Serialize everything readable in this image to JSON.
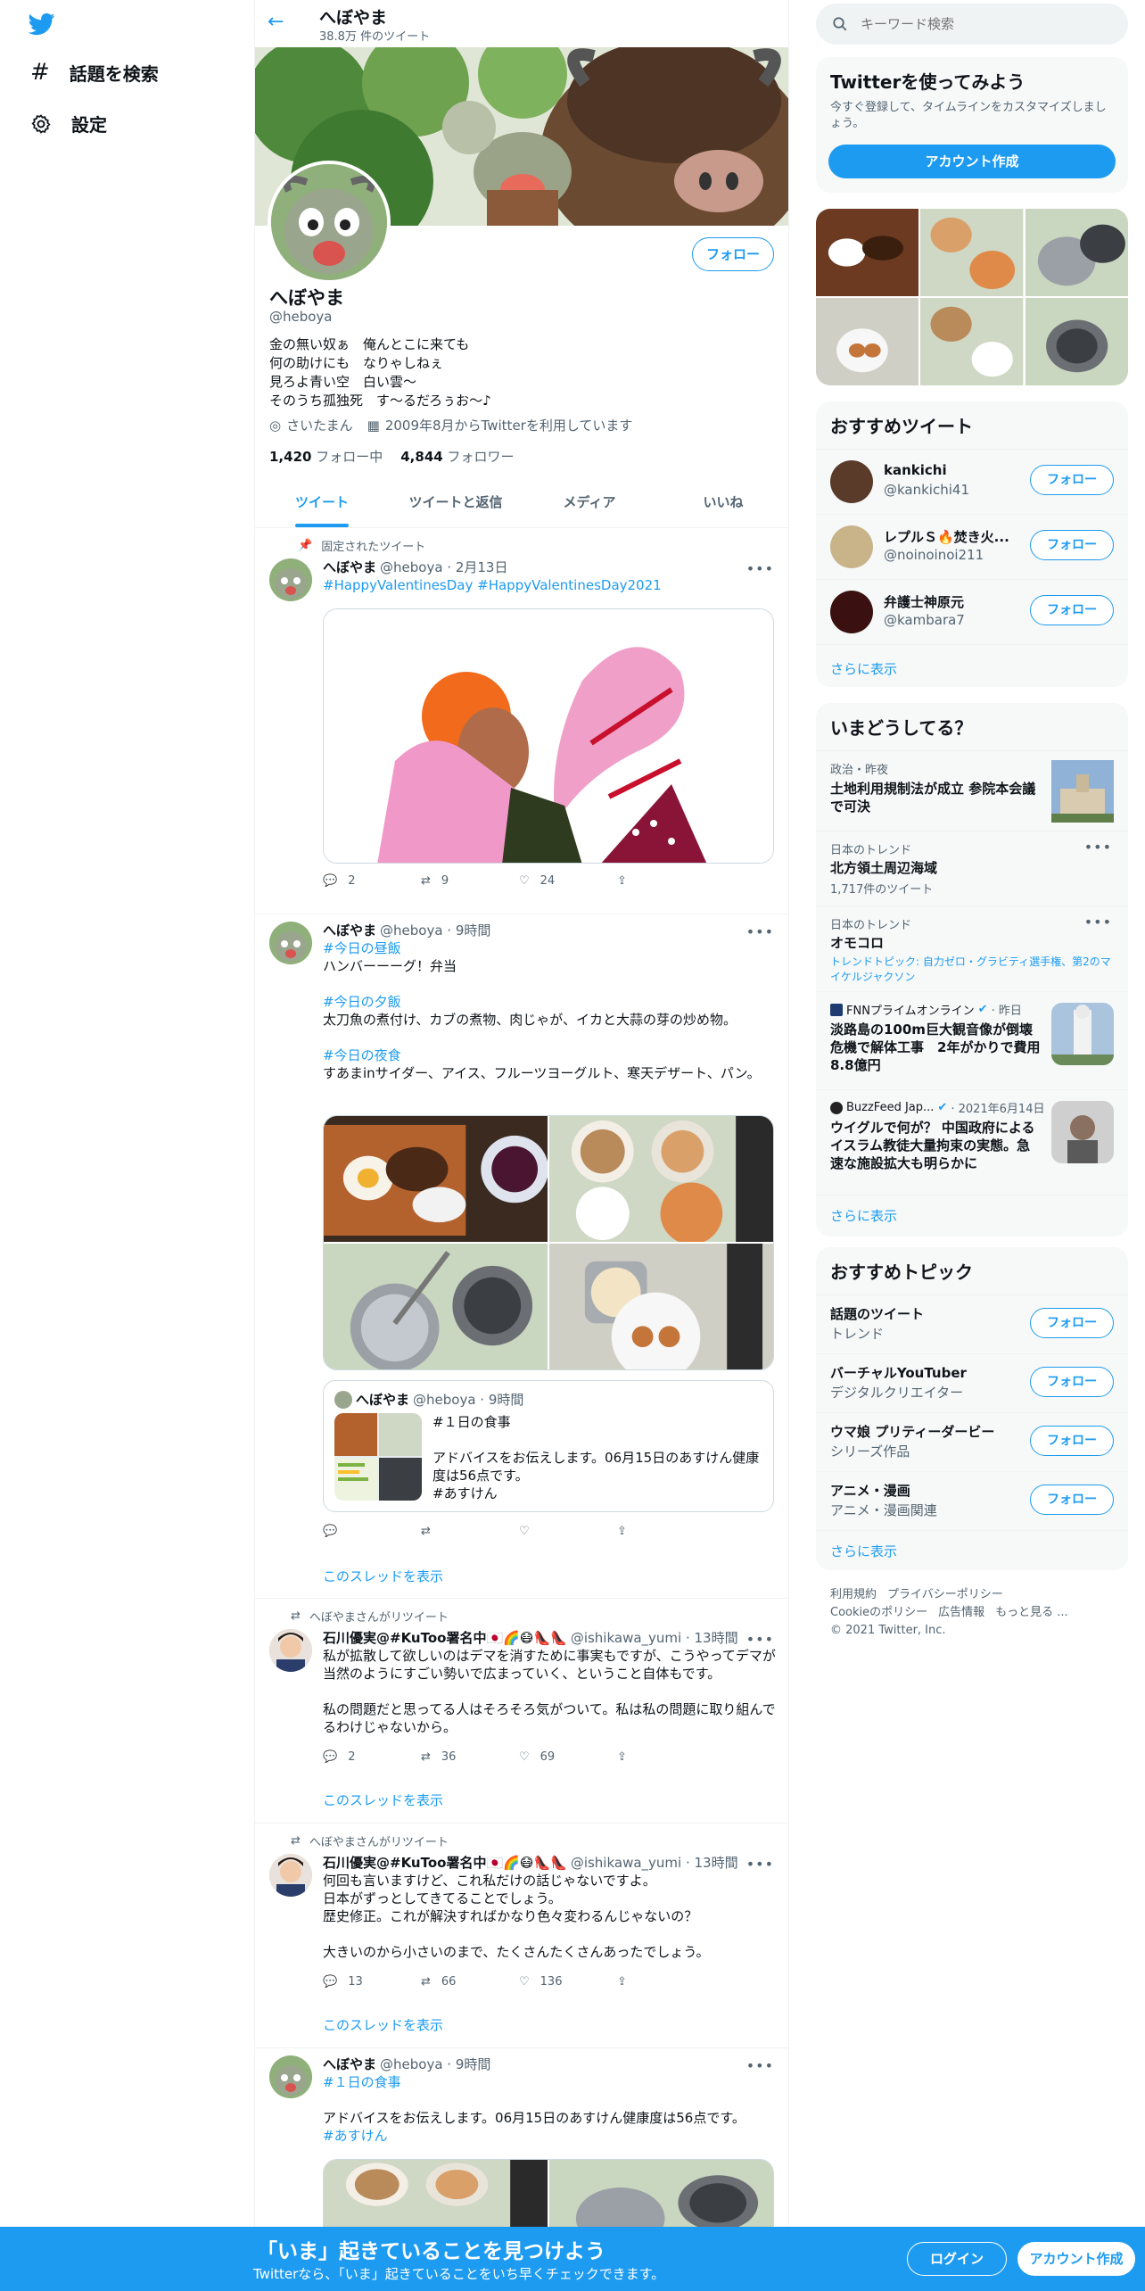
{
  "nav": {
    "explore": "話題を検索",
    "settings": "設定"
  },
  "header": {
    "name": "へぼやま",
    "tweet_count": "38.8万 件のツイート"
  },
  "profile": {
    "follow": "フォロー",
    "name": "へぼやま",
    "handle": "@heboya",
    "bio": [
      "金の無い奴ぁ　俺んとこに来ても",
      "何の助けにも　なりゃしねぇ",
      "見ろよ青い空　白い雲～",
      "そのうち孤独死　す～るだろぅお～♪"
    ],
    "location": "さいたまん",
    "joined": "2009年8月からTwitterを利用しています",
    "following_count": "1,420",
    "following_label": "フォロー中",
    "followers_count": "4,844",
    "followers_label": "フォロワー"
  },
  "tabs": [
    "ツイート",
    "ツイートと返信",
    "メディア",
    "いいね"
  ],
  "tweets": [
    {
      "context": "固定されたツイート",
      "name": "へぼやま",
      "meta": "@heboya · 2月13日",
      "lines": [
        "#HappyValentinesDay #HappyValentinesDay2021"
      ],
      "counts": [
        "2",
        "9",
        "24"
      ]
    },
    {
      "name": "へぼやま",
      "meta": "@heboya · 9時間",
      "lines": [
        "#今日の昼飯",
        "ハンバーーーグ！弁当",
        "",
        "#今日の夕飯",
        "太刀魚の煮付け、カブの煮物、肉じゃが、イカと大蒜の芽の炒め物。",
        "",
        "#今日の夜食",
        "すあまinサイダー、アイス、フルーツヨーグルト、寒天デザート、パン。"
      ],
      "quote": {
        "name": "へぼやま",
        "meta": "@heboya · 9時間",
        "lines": [
          "#１日の食事",
          "",
          "アドバイスをお伝えします。06月15日のあすけん健康度は56点です。",
          "#あすけん"
        ]
      },
      "thread": "このスレッドを表示"
    },
    {
      "context": "へぼやまさんがリツイート",
      "name": "石川優実@#KuToo署名中🇯🇵🌈😷👠👠",
      "meta": "@ishikawa_yumi · 13時間",
      "lines": [
        "私が拡散して欲しいのはデマを消すために事実もですが、こうやってデマが当然のようにすごい勢いで広まっていく、ということ自体もです。",
        "",
        "私の問題だと思ってる人はそろそろ気がついて。私は私の問題に取り組んでるわけじゃないから。"
      ],
      "counts": [
        "2",
        "36",
        "69"
      ],
      "thread": "このスレッドを表示"
    },
    {
      "context": "へぼやまさんがリツイート",
      "name": "石川優実@#KuToo署名中🇯🇵🌈😷👠👠",
      "meta": "@ishikawa_yumi · 13時間",
      "lines": [
        "何回も言いますけど、これ私だけの話じゃないですよ。",
        "日本がずっとしてきてることでしょう。",
        "歴史修正。これが解決すればかなり色々変わるんじゃないの？",
        "",
        "大きいのから小さいのまで、たくさんたくさんあったでしょう。"
      ],
      "counts": [
        "13",
        "66",
        "136"
      ],
      "thread": "このスレッドを表示"
    },
    {
      "name": "へぼやま",
      "meta": "@heboya · 9時間",
      "lines": [
        "#１日の食事",
        "",
        "アドバイスをお伝えします。06月15日のあすけん健康度は56点です。",
        "#あすけん"
      ]
    }
  ],
  "right": {
    "search_placeholder": "キーワード検索",
    "signup_title": "Twitterを使ってみよう",
    "signup_desc": "今すぐ登録して、タイムラインをカスタマイズしましょう。",
    "signup_button": "アカウント作成",
    "who_title": "おすすめツイート",
    "who": [
      {
        "name": "kankichi",
        "handle": "@kankichi41"
      },
      {
        "name": "レプルＳ🔥焚き火...",
        "handle": "@noinoinoi211"
      },
      {
        "name": "弁護士神原元",
        "handle": "@kambara7"
      }
    ],
    "follow": "フォロー",
    "show_more": "さらに表示",
    "trends_title": "いまどうしてる？",
    "trends": [
      {
        "context": "政治・昨夜",
        "title": "土地利用規制法が成立 参院本会議で可決"
      },
      {
        "context": "日本のトレンド",
        "title": "北方領土周辺海域",
        "sub": "1,717件のツイート"
      },
      {
        "context": "日本のトレンド",
        "title": "オモコロ",
        "sub": "トレンドトピック: 自力ゼロ・グラビティ選手権、第2のマイケルジャクソン"
      },
      {
        "source": "FNNプライムオンライン",
        "time": "· 昨日",
        "title": "淡路島の100m巨大観音像が倒壊危機で解体工事　2年がかりで費用8.8億円"
      },
      {
        "source": "BuzzFeed Jap...",
        "time": "· 2021年6月14日",
        "title": "ウイグルで何が？ 中国政府によるイスラム教徒大量拘束の実態。急速な施設拡大も明らかに"
      }
    ],
    "topics_title": "おすすめトピック",
    "topics": [
      {
        "name": "話題のツイート",
        "sub": "トレンド"
      },
      {
        "name": "バーチャルYouTuber",
        "sub": "デジタルクリエイター"
      },
      {
        "name": "ウマ娘 プリティーダービー",
        "sub": "シリーズ作品"
      },
      {
        "name": "アニメ・漫画",
        "sub": "アニメ・漫画関連"
      }
    ],
    "footer": [
      "利用規約",
      "プライバシーポリシー",
      "Cookieのポリシー",
      "広告情報",
      "もっと見る ...",
      "© 2021 Twitter, Inc."
    ]
  },
  "bottom": {
    "title": "「いま」起きていることを見つけよう",
    "subtitle": "Twitterなら、「いま」起きていることをいち早くチェックできます。",
    "login": "ログイン",
    "signup": "アカウント作成"
  }
}
